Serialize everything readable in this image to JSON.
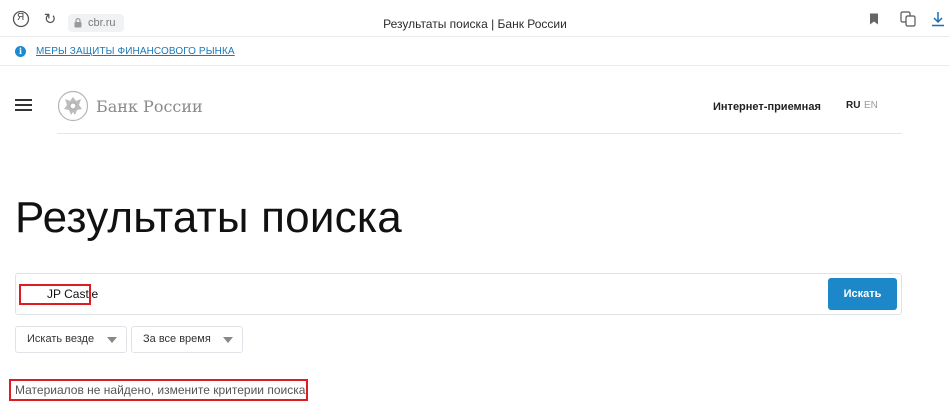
{
  "browser": {
    "yandex_glyph": "Я",
    "reload_glyph": "↻",
    "address": "cbr.ru",
    "tab_title": "Результаты поиска | Банк России"
  },
  "info_strip": {
    "icon": "i",
    "link_text": "МЕРЫ ЗАЩИТЫ ФИНАНСОВОГО РЫНКА"
  },
  "header": {
    "brand": "Банк России",
    "reception": "Интернет-приемная",
    "lang_active": "RU",
    "lang_other": "EN"
  },
  "page": {
    "title": "Результаты поиска"
  },
  "search": {
    "value": "JP Castle",
    "button_label": "Искать"
  },
  "filters": {
    "where": "Искать везде",
    "time": "За все время"
  },
  "result": {
    "message": "Материалов не найдено, измените критерии поиска"
  },
  "colors": {
    "accent": "#1d88c9",
    "link": "#1b79b7",
    "annotation": "#e01b22"
  }
}
